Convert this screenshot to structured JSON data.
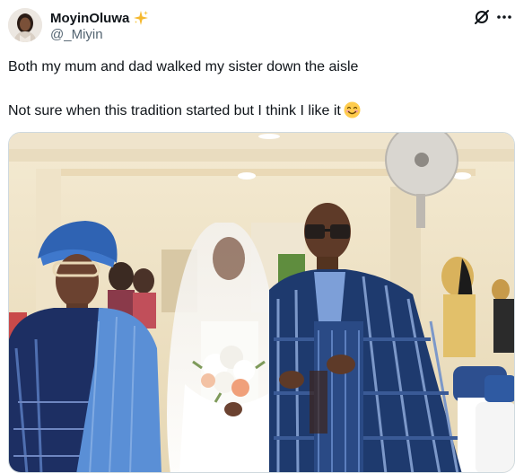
{
  "author": {
    "display_name": "MoyinOluwa",
    "handle": "@_Miyin",
    "badge_icon": "sparkles-icon"
  },
  "tweet": {
    "line1": "Both my mum and dad walked my sister down the aisle",
    "line2": "Not sure when this tradition started but I think I like it",
    "emoji": "smiling-face-icon"
  },
  "header_icons": [
    "grok-icon",
    "more-icon"
  ],
  "colors": {
    "text": "#0f1419",
    "secondary": "#536471",
    "sparkle": "#f5b82e",
    "agbada_blue": "#1e3a6e"
  }
}
